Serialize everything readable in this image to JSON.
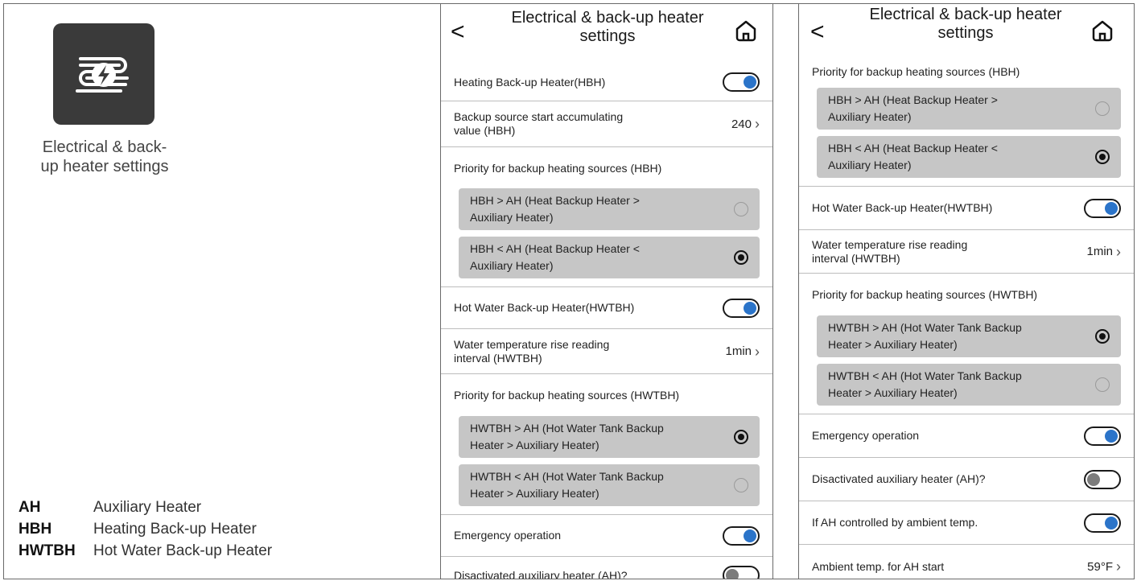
{
  "left_panel": {
    "app_label": "Electrical & back-up heater settings",
    "app_label_lines": [
      "Electrical & back-",
      "up heater settings"
    ],
    "app_icon": "heater-lightning-icon",
    "legend": [
      {
        "abbr": "AH",
        "desc": "Auxiliary Heater"
      },
      {
        "abbr": "HBH",
        "desc": "Heating Back-up Heater"
      },
      {
        "abbr": "HWTBH",
        "desc": "Hot Water Back-up Heater"
      }
    ]
  },
  "screen1": {
    "title_line1": "Electrical & back-up heater",
    "title_line2": "settings",
    "hbh_toggle_label": "Heating Back-up Heater(HBH)",
    "hbh_toggle_on": true,
    "backup_start_label_1": "Backup source start accumulating",
    "backup_start_label_2": "value (HBH)",
    "backup_start_value": "240",
    "hbh_priority_title": "Priority for backup heating sources (HBH)",
    "hbh_opt1_line1": "HBH > AH (Heat Backup Heater >",
    "hbh_opt1_line2": "Auxiliary Heater)",
    "hbh_opt2_line1": "HBH < AH (Heat Backup Heater <",
    "hbh_opt2_line2": "Auxiliary Heater)",
    "hwtbh_toggle_label": "Hot Water Back-up Heater(HWTBH)",
    "water_rise_label_1": "Water temperature rise reading",
    "water_rise_label_2": "interval (HWTBH)",
    "water_rise_value": "1min",
    "hwtbh_priority_title": "Priority for backup heating sources (HWTBH)",
    "hwtbh_opt1_line1": "HWTBH > AH (Hot Water Tank Backup",
    "hwtbh_opt1_line2": "Heater > Auxiliary Heater)",
    "hwtbh_opt2_line1": "HWTBH < AH (Hot Water Tank Backup",
    "hwtbh_opt2_line2": "Heater > Auxiliary Heater)",
    "emergency_label": "Emergency operation",
    "disact_label": "Disactivated auxiliary heater (AH)?"
  },
  "screen2": {
    "title_line1": "Electrical & back-up heater",
    "title_line2": "settings",
    "hbh_priority_title": "Priority for backup heating sources (HBH)",
    "hbh_opt1_line1": "HBH > AH (Heat Backup Heater >",
    "hbh_opt1_line2": "Auxiliary Heater)",
    "hbh_opt2_line1": "HBH < AH (Heat Backup Heater <",
    "hbh_opt2_line2": "Auxiliary Heater)",
    "hwtbh_toggle_label": "Hot Water Back-up Heater(HWTBH)",
    "water_rise_label_1": "Water temperature rise reading",
    "water_rise_label_2": "interval (HWTBH)",
    "water_rise_value": "1min",
    "hwtbh_priority_title": "Priority for backup heating sources (HWTBH)",
    "hwtbh_opt1_line1": "HWTBH > AH (Hot Water Tank Backup",
    "hwtbh_opt1_line2": "Heater > Auxiliary Heater)",
    "hwtbh_opt2_line1": "HWTBH < AH (Hot Water Tank Backup",
    "hwtbh_opt2_line2": "Heater > Auxiliary Heater)",
    "emergency_label": "Emergency operation",
    "disact_label": "Disactivated auxiliary heater (AH)?",
    "ah_ambient_label": "If AH controlled by ambient temp.",
    "ambient_temp_label": "Ambient temp. for AH start",
    "ambient_temp_value": "59°F"
  },
  "colors": {
    "toggle_on": "#2b74c9",
    "toggle_off": "#7c7c7c",
    "option_bg": "#c6c6c6",
    "app_tile_bg": "#3a3a3a"
  }
}
